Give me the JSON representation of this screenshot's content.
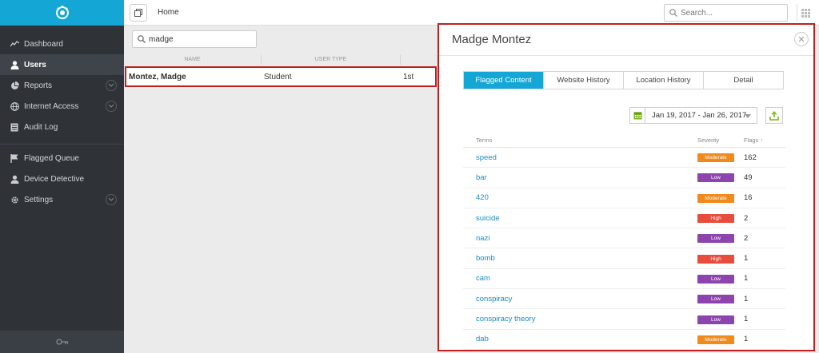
{
  "sidebar": {
    "items": [
      {
        "label": "Dashboard",
        "icon": "dashboard-icon",
        "active": false,
        "expandable": false
      },
      {
        "label": "Users",
        "icon": "user-icon",
        "active": true,
        "expandable": false
      },
      {
        "label": "Reports",
        "icon": "pie-chart-icon",
        "active": false,
        "expandable": true
      },
      {
        "label": "Internet Access",
        "icon": "globe-icon",
        "active": false,
        "expandable": true
      },
      {
        "label": "Audit Log",
        "icon": "log-icon",
        "active": false,
        "expandable": false
      }
    ],
    "items2": [
      {
        "label": "Flagged Queue",
        "icon": "flag-icon",
        "expandable": false
      },
      {
        "label": "Device Detective",
        "icon": "detective-icon",
        "expandable": false
      },
      {
        "label": "Settings",
        "icon": "gear-icon",
        "expandable": true
      }
    ]
  },
  "topbar": {
    "breadcrumb": "Home",
    "search_placeholder": "Search..."
  },
  "users": {
    "search_value": "madge",
    "columns": [
      "NAME",
      "USER TYPE",
      ""
    ],
    "rows": [
      {
        "name": "Montez, Madge",
        "type": "Student",
        "grade": "1st"
      }
    ]
  },
  "panel": {
    "title": "Madge Montez",
    "tabs": [
      "Flagged Content",
      "Website History",
      "Location History",
      "Detail"
    ],
    "active_tab": 0,
    "date_range": "Jan 19, 2017 - Jan 26, 2017",
    "table": {
      "headers": {
        "terms": "Terms",
        "severity": "Severity",
        "flags": "Flags"
      },
      "rows": [
        {
          "term": "speed",
          "severity": "Moderate",
          "flags": "162"
        },
        {
          "term": "bar",
          "severity": "Low",
          "flags": "49"
        },
        {
          "term": "420",
          "severity": "Moderate",
          "flags": "16"
        },
        {
          "term": "suicide",
          "severity": "High",
          "flags": "2"
        },
        {
          "term": "nazi",
          "severity": "Low",
          "flags": "2"
        },
        {
          "term": "bomb",
          "severity": "High",
          "flags": "1"
        },
        {
          "term": "cam",
          "severity": "Low",
          "flags": "1"
        },
        {
          "term": "conspiracy",
          "severity": "Low",
          "flags": "1"
        },
        {
          "term": "conspiracy theory",
          "severity": "Low",
          "flags": "1"
        },
        {
          "term": "dab",
          "severity": "Moderate",
          "flags": "1"
        }
      ]
    }
  },
  "colors": {
    "accent": "#14a7d6",
    "highlight_border": "#c0201f",
    "moderate": "#f08a1c",
    "low": "#8e44ad",
    "high": "#e74c3c"
  }
}
